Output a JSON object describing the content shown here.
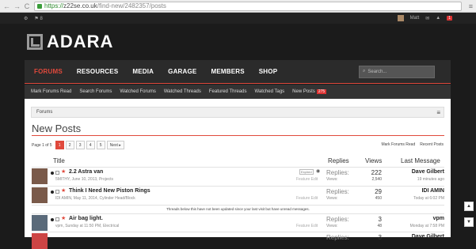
{
  "browser": {
    "scheme": "https://",
    "host": "z22se.co.uk",
    "path": "/find-new/2482357/posts"
  },
  "topbar": {
    "user": "Matt",
    "alerts": "1",
    "flag_count": "8"
  },
  "logo": "ADARA",
  "nav": {
    "tabs": [
      "FORUMS",
      "RESOURCES",
      "MEDIA",
      "GARAGE",
      "MEMBERS",
      "SHOP"
    ],
    "search_placeholder": "Search..."
  },
  "subnav": {
    "items": [
      "Mark Forums Read",
      "Search Forums",
      "Watched Forums",
      "Watched Threads",
      "Featured Threads",
      "Watched Tags",
      "New Posts"
    ],
    "new_posts_count": "275"
  },
  "breadcrumb": "Forums",
  "page_title": "New Posts",
  "pager": {
    "label": "Page 1 of 5",
    "pages": [
      "1",
      "2",
      "3",
      "4",
      "5"
    ],
    "next": "Next ▸"
  },
  "mark_links": [
    "Mark Forums Read",
    "Recent Posts"
  ],
  "columns": {
    "title": "Title",
    "replies": "Replies",
    "views": "Views",
    "last": "Last Message"
  },
  "threads": [
    {
      "title": "2.2 Astra van",
      "meta": "5MITHY, June 10, 2013, Projects",
      "tag": "Expired",
      "feature": "Feature Edit",
      "replies_label": "Replies:",
      "views_label": "Views:",
      "replies": "222",
      "views": "2,540",
      "last_user": "Dave Gilbert",
      "last_date": "19 minutes ago"
    },
    {
      "title": "Think I Need New Piston Rings",
      "meta": "IDI AMIN, May 11, 2014, Cylinder Head/Block",
      "tag": "",
      "feature": "Feature Edit",
      "replies_label": "Replies:",
      "views_label": "Views:",
      "replies": "29",
      "views": "450",
      "last_user": "IDI AMIN",
      "last_date": "Today at 6:02 PM"
    },
    {
      "title": "Air bag light.",
      "meta": "vpm, Sunday at 11:50 PM, Electrical",
      "tag": "",
      "feature": "Feature Edit",
      "replies_label": "Replies:",
      "views_label": "Views:",
      "replies": "3",
      "views": "48",
      "last_user": "vpm",
      "last_date": "Monday at 7:58 PM"
    },
    {
      "title": "",
      "meta": "",
      "tag": "",
      "feature": "",
      "replies_label": "Replies:",
      "views_label": "",
      "replies": "3",
      "views": "",
      "last_user": "Dave Gilbert",
      "last_date": ""
    }
  ],
  "notice": "Threads below this have not been updated since your last visit but have unread messages.",
  "scroll_up": "▲",
  "scroll_down": "▼",
  "colors": {
    "accent": "#e0493c",
    "dark": "#1b1b1b"
  }
}
